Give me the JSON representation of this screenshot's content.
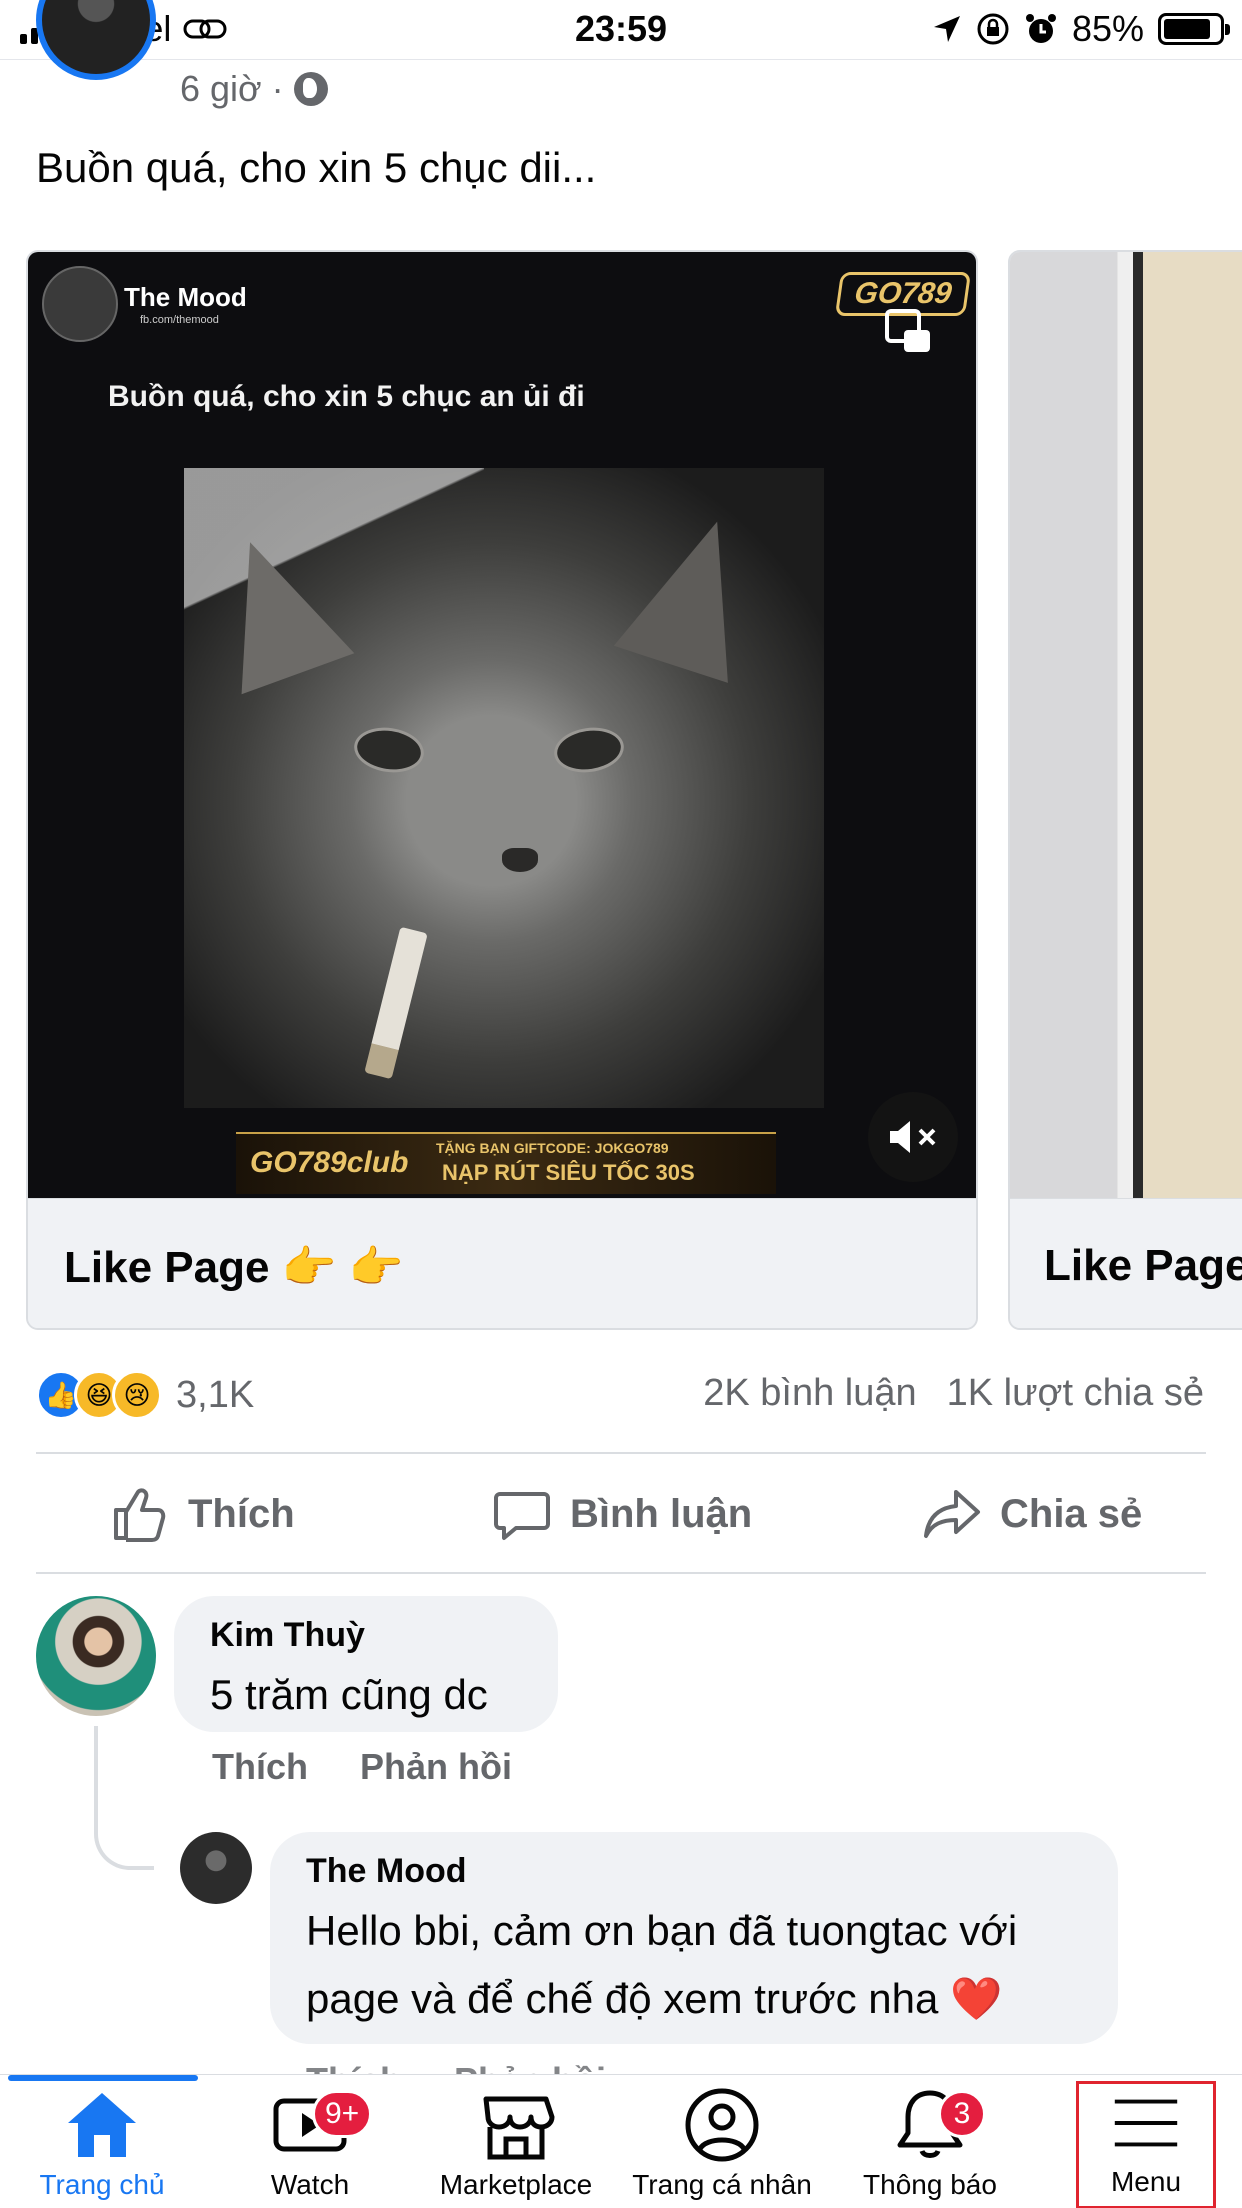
{
  "status_bar": {
    "carrier": "Viettel",
    "time": "23:59",
    "battery_percent": "85%",
    "battery_level": 0.85
  },
  "post": {
    "time": "6 giờ",
    "separator": "·",
    "text": "Buồn quá, cho xin 5 chục dii..."
  },
  "carousel": {
    "card1": {
      "page_name": "The Mood",
      "page_sub": "fb.com/themood",
      "brand_badge": "GO789",
      "video_caption": "Buồn quá, cho xin 5 chục an ủi đi",
      "banner_brand": "GO789club",
      "banner_line1": "TẶNG BẠN GIFTCODE: JOKGO789",
      "banner_line2": "NẠP RÚT SIÊU TỐC 30S",
      "cta": "Like Page 👉 👉"
    },
    "card2": {
      "cta": "Like Page"
    }
  },
  "reactions": {
    "like_glyph": "👍",
    "haha_glyph": "😆",
    "sad_glyph": "😢",
    "count": "3,1K",
    "comments": "2K bình luận",
    "shares": "1K lượt chia sẻ"
  },
  "actions": {
    "like": "Thích",
    "comment": "Bình luận",
    "share": "Chia sẻ"
  },
  "comments": [
    {
      "author": "Kim Thuỳ",
      "text": "5 trăm cũng dc",
      "like": "Thích",
      "reply": "Phản hồi"
    },
    {
      "author": "The Mood",
      "text_line1": "Hello bbi, cảm ơn bạn đã tuongtac với",
      "text_line2": "page và để chế độ xem trước nha",
      "heart": "❤️",
      "like": "Thích",
      "reply": "Phản hồi"
    }
  ],
  "tab_bar": {
    "home": "Trang chủ",
    "watch": "Watch",
    "watch_badge": "9+",
    "marketplace": "Marketplace",
    "profile": "Trang cá nhân",
    "notifications": "Thông báo",
    "notifications_badge": "3",
    "menu": "Menu"
  },
  "colors": {
    "accent": "#1877f2",
    "badge": "#e41e3f",
    "highlight_box": "#e0242f"
  }
}
